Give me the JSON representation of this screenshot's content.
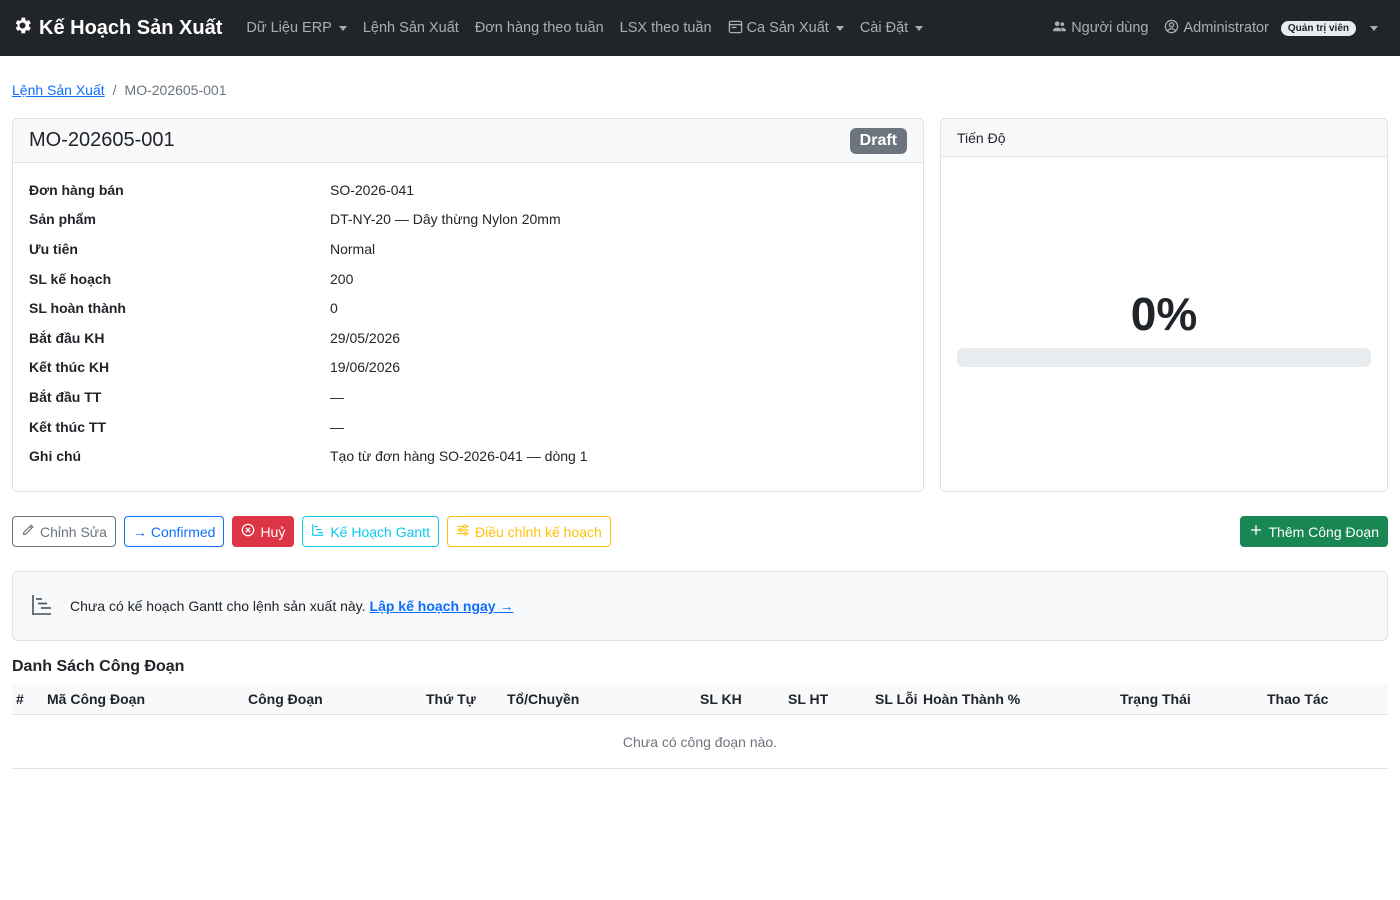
{
  "app": {
    "brand": "Kế Hoạch Sản Xuất",
    "nav": [
      {
        "label": "Dữ Liệu ERP",
        "dropdown": true,
        "icon": ""
      },
      {
        "label": "Lệnh Sản Xuất",
        "dropdown": false,
        "icon": ""
      },
      {
        "label": "Đơn hàng theo tuần",
        "dropdown": false,
        "icon": ""
      },
      {
        "label": "LSX theo tuần",
        "dropdown": false,
        "icon": ""
      },
      {
        "label": "Ca Sản Xuất",
        "dropdown": true,
        "icon": "calendar-icon"
      },
      {
        "label": "Cài Đặt",
        "dropdown": true,
        "icon": ""
      }
    ],
    "users_label": "Người dùng",
    "account_label": "Administrator",
    "role_badge": "Quản trị viên"
  },
  "breadcrumb": {
    "parent": "Lệnh Sản Xuất",
    "current": "MO-202605-001"
  },
  "order": {
    "code": "MO-202605-001",
    "status": "Draft",
    "details": [
      {
        "label": "Đơn hàng bán",
        "value": "SO-2026-041"
      },
      {
        "label": "Sản phẩm",
        "value": "DT-NY-20 — Dây thừng Nylon 20mm"
      },
      {
        "label": "Ưu tiên",
        "value": "Normal"
      },
      {
        "label": "SL kế hoạch",
        "value": "200"
      },
      {
        "label": "SL hoàn thành",
        "value": "0"
      },
      {
        "label": "Bắt đầu KH",
        "value": "29/05/2026"
      },
      {
        "label": "Kết thúc KH",
        "value": "19/06/2026"
      },
      {
        "label": "Bắt đầu TT",
        "value": "—"
      },
      {
        "label": "Kết thúc TT",
        "value": "—"
      },
      {
        "label": "Ghi chú",
        "value": "Tạo từ đơn hàng SO-2026-041 — dòng 1"
      }
    ]
  },
  "progress": {
    "title": "Tiến Độ",
    "value_text": "0%",
    "fraction": 0
  },
  "actions": {
    "edit": "Chỉnh Sửa",
    "confirm": "→ Confirmed",
    "cancel": "Huỷ",
    "gantt": "Kế Hoạch Gantt",
    "adjust": "Điều chỉnh kế hoạch",
    "add_stage": "Thêm Công Đoạn"
  },
  "gantt_notice": {
    "message": "Chưa có kế hoạch Gantt cho lệnh sản xuất này.",
    "link": "Lập kế hoạch ngay →"
  },
  "stages": {
    "title": "Danh Sách Công Đoạn",
    "columns": [
      "#",
      "Mã Công Đoạn",
      "Công Đoạn",
      "Thứ Tự",
      "Tổ/Chuyền",
      "SL KH",
      "SL HT",
      "SL Lỗi",
      "Hoàn Thành %",
      "Trạng Thái",
      "Thao Tác"
    ],
    "empty_text": "Chưa có công đoạn nào."
  },
  "colors": {
    "navbar": "#212529",
    "primary": "#0d6efd",
    "danger": "#dc3545",
    "success": "#198754",
    "info": "#0dcaf0",
    "warning": "#ffc107",
    "draft_badge": "#6c757d"
  }
}
